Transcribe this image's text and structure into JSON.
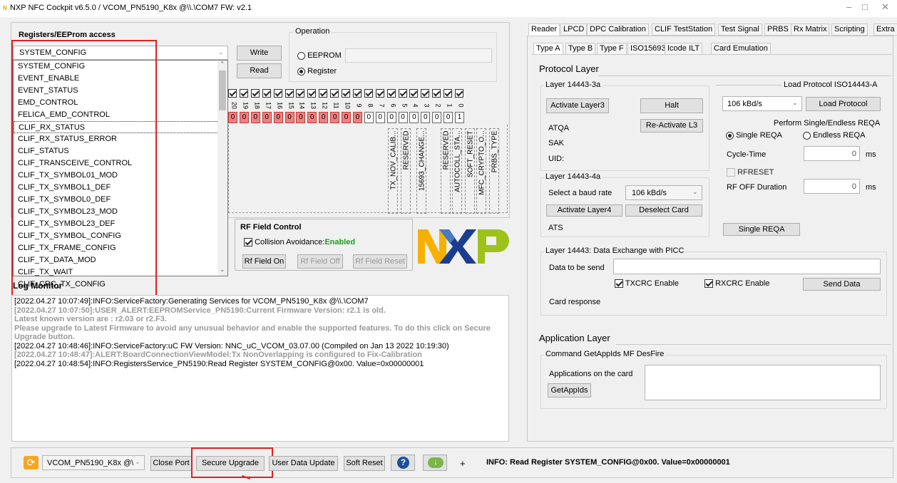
{
  "window": {
    "title": "NXP NFC Cockpit v6.5.0 / VCOM_PN5190_K8x @\\\\.\\COM7  FW: v2.1",
    "min": "–",
    "max": "□",
    "close": "✕"
  },
  "registers": {
    "title": "Registers/EEProm access",
    "selected": "SYSTEM_CONFIG",
    "write": "Write",
    "read": "Read",
    "operation_title": "Operation",
    "op_eeprom": "EEPROM",
    "op_register": "Register",
    "list": [
      "SYSTEM_CONFIG",
      "EVENT_ENABLE",
      "EVENT_STATUS",
      "EMD_CONTROL",
      "FELICA_EMD_CONTROL",
      "CLIF_RX_STATUS",
      "CLIF_RX_STATUS_ERROR",
      "CLIF_STATUS",
      "CLIF_TRANSCEIVE_CONTROL",
      "CLIF_TX_SYMBOL01_MOD",
      "CLIF_TX_SYMBOL1_DEF",
      "CLIF_TX_SYMBOL0_DEF",
      "CLIF_TX_SYMBOL23_MOD",
      "CLIF_TX_SYMBOL23_DEF",
      "CLIF_TX_SYMBOL_CONFIG",
      "CLIF_TX_FRAME_CONFIG",
      "CLIF_TX_DATA_MOD",
      "CLIF_TX_WAIT",
      "CLIF_CRC_TX_CONFIG"
    ],
    "bit_numbers": [
      "20",
      "19",
      "18",
      "17",
      "16",
      "15",
      "14",
      "13",
      "12",
      "11",
      "10",
      "9",
      "8",
      "7",
      "6",
      "5",
      "4",
      "3",
      "2",
      "1",
      "0"
    ],
    "bit_values": [
      "0",
      "0",
      "0",
      "0",
      "0",
      "0",
      "0",
      "0",
      "0",
      "0",
      "0",
      "0",
      "0",
      "0",
      "0",
      "0",
      "0",
      "0",
      "0",
      "0",
      "1"
    ],
    "bit_labels": [
      "TX_NOV_CALIB...",
      "RESERVED",
      "15693_CHANGE...",
      "RESERVED",
      "AUTOCOLL_STA...",
      "SOFT_RESET",
      "MFC_CRYPTO_O...",
      "PRBS_TYPE"
    ]
  },
  "rf": {
    "title": "RF Field Control",
    "collision": "Collision Avoidance:",
    "collision_state": "Enabled",
    "on": "Rf Field On",
    "off": "Rf Field Off",
    "reset": "Rf Field Reset"
  },
  "log": {
    "title": "Log Monitor",
    "lines": [
      {
        "t": "[2022.04.27 10:07:49]:INFO:ServiceFactory:Generating Services for VCOM_PN5190_K8x @\\\\.\\COM7",
        "c": "n"
      },
      {
        "t": "[2022.04.27 10:07:50]:USER_ALERT:EEPROMService_PN5190:Current Firmware Version: r2.1 is old.",
        "c": "g"
      },
      {
        "t": "Latest known version are : r2.03 or r2.F3.",
        "c": "g"
      },
      {
        "t": "Please upgrade to Latest Firmware to avoid any unusual behavior and enable the supported features. To do this click on Secure Upgrade button.",
        "c": "g"
      },
      {
        "t": "[2022.04.27 10:48:46]:INFO:ServiceFactory:uC FW Version: NNC_uC_VCOM_03.07.00 (Compiled on Jan 13 2022 10:19:30)",
        "c": "n"
      },
      {
        "t": "[2022.04.27 10:48:47]:ALERT:BoardConnectionViewModel:Tx NonOverlapping is configured to Fix-Calibration",
        "c": "g"
      },
      {
        "t": "[2022.04.27 10:48:54]:INFO:RegistersService_PN5190:Read Register SYSTEM_CONFIG@0x00. Value=0x00000001",
        "c": "n"
      }
    ]
  },
  "tabs": [
    "Reader",
    "LPCD",
    "DPC Calibration",
    "CLIF TestStation",
    "Test Signal",
    "PRBS",
    "Rx Matrix",
    "Scripting",
    "Extra"
  ],
  "subtabs": [
    "Type A",
    "Type B",
    "Type F",
    "ISO15693",
    "Icode ILT",
    "Card Emulation"
  ],
  "protocol": {
    "title": "Protocol Layer",
    "l3a": "Layer 14443-3a",
    "activate3": "Activate Layer3",
    "halt": "Halt",
    "reactivate": "Re-Activate L3",
    "atqa": "ATQA",
    "sak": "SAK",
    "uid": "UID:",
    "l4a": "Layer 14443-4a",
    "baud_label": "Select a baud rate",
    "baud": "106 kBd/s",
    "activate4": "Activate Layer4",
    "deselect": "Deselect Card",
    "ats": "ATS",
    "load_title": "Load Protocol ISO14443-A",
    "load_baud": "106 kBd/s",
    "load_btn": "Load Protocol",
    "reqa_title": "Perform Single/Endless REQA",
    "single": "Single REQA",
    "endless": "Endless REQA",
    "cycle": "Cycle-Time",
    "cycle_val": "0",
    "ms": "ms",
    "rfreset": "RFRESET",
    "rfoff": "RF OFF Duration",
    "rfoff_val": "0",
    "single_btn": "Single REQA",
    "dx_title": "Layer 14443: Data Exchange with PICC",
    "data_label": "Data to be send",
    "txcrc": "TXCRC Enable",
    "rxcrc": "RXCRC Enable",
    "send": "Send Data",
    "resp": "Card response"
  },
  "app": {
    "title": "Application Layer",
    "cmd": "Command GetAppIds MF DesFire",
    "apps": "Applications on the card",
    "btn": "GetAppIds"
  },
  "bottom": {
    "port": "VCOM_PN5190_K8x @\\",
    "close": "Close Port",
    "secure": "Secure Upgrade",
    "userdata": "User Data Update",
    "soft": "Soft Reset",
    "plus": "+",
    "status": "INFO: Read Register SYSTEM_CONFIG@0x00. Value=0x00000001"
  }
}
